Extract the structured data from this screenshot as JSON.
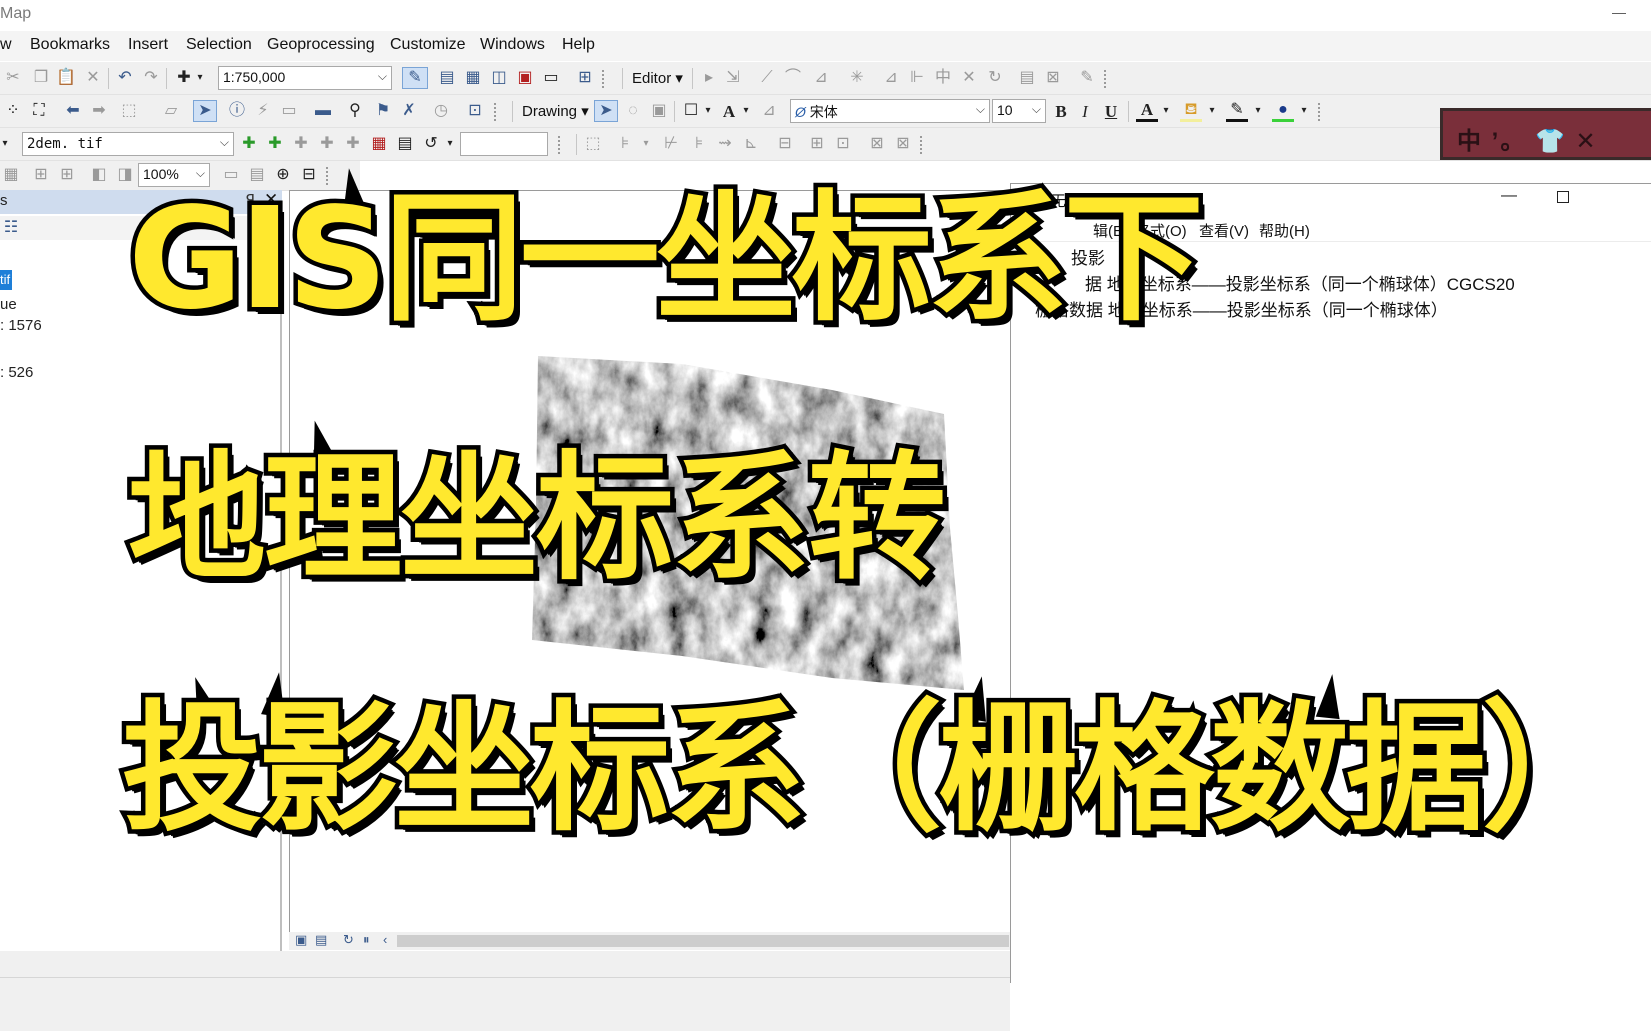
{
  "window": {
    "app_title": "Map",
    "minimize_glyph": "—"
  },
  "menubar": {
    "items": [
      "w",
      "Bookmarks",
      "Insert",
      "Selection",
      "Geoprocessing",
      "Customize",
      "Windows",
      "Help"
    ]
  },
  "toolbar_standard": {
    "scale": "1:750,000",
    "editor_label": "Editor",
    "icons": [
      "cut-icon",
      "copy-icon",
      "paste-icon",
      "delete-icon",
      "undo-icon",
      "redo-icon",
      "add-data-icon",
      "editor-toolbar-icon",
      "table-icon",
      "catalog-icon",
      "search-icon",
      "arctoolbox-icon",
      "python-icon",
      "model-icon"
    ]
  },
  "toolbar_draw": {
    "drawing_label": "Drawing",
    "font_name": "宋体",
    "font_size": "10",
    "bold": "B",
    "italic": "I",
    "underline": "U",
    "font_color_letter": "A",
    "text_letter": "A"
  },
  "toolbar_effects": {
    "layer": "2dem. tif",
    "zoom_percent": "100%",
    "textbox_value": ""
  },
  "ime": {
    "text": "中 ’。 👕 ✕"
  },
  "toc": {
    "title": "s",
    "pin": "ꟼ",
    "close": "✕",
    "layer_chip": "tif",
    "lines": [
      "ue",
      ": 1576",
      ": 526"
    ]
  },
  "notepad": {
    "title": "*无标题 - 记事本",
    "menu": [
      "辑(E)",
      "格式(O)",
      "查看(V)",
      "帮助(H)"
    ],
    "lines": [
      "投影",
      "据  地理坐标系——投影坐标系（同一个椭球体）CGCS20",
      "栅格数据   地理坐标系——投影坐标系（同一个椭球体）"
    ]
  },
  "headline": {
    "line1": "GIS同一坐标系下",
    "line2": "地理坐标系转",
    "line3": "投影坐标系（栅格数据）"
  },
  "colors": {
    "headline_fill": "#ffe82e",
    "headline_stroke": "#000000",
    "toc_header": "#cfdcee",
    "selection_blue": "#1e7fd8"
  }
}
